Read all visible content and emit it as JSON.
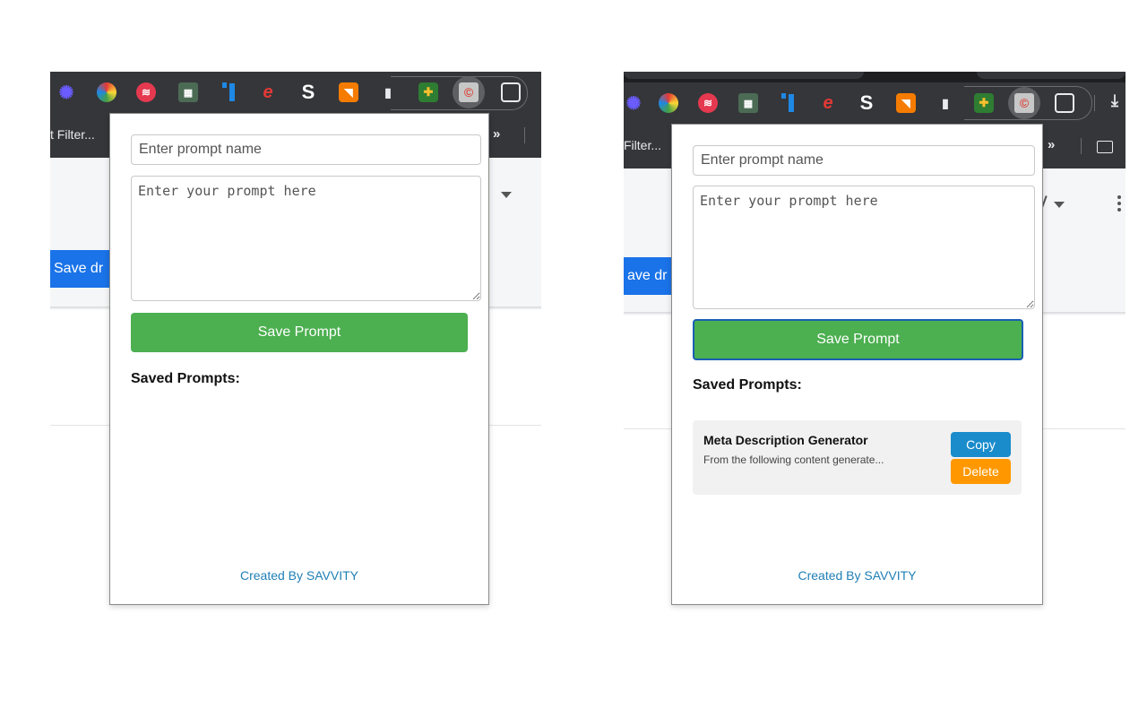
{
  "colors": {
    "chrome_dark": "#35363a",
    "save_button": "#4caf50",
    "copy_button": "#1a8ccc",
    "delete_button": "#ff9800",
    "link": "#1f7fb5",
    "page_button": "#1a73e8"
  },
  "left": {
    "bookmark_label": "t Filter...",
    "bookmark_more": "»",
    "page_button_label": "Save dr",
    "popup": {
      "name_placeholder": "Enter prompt name",
      "prompt_placeholder": "Enter your prompt here",
      "save_label": "Save Prompt",
      "saved_heading": "Saved Prompts:",
      "footer": "Created By SAVVITY"
    }
  },
  "right": {
    "bookmark_label": "Filter...",
    "bookmark_more": "»",
    "page_button_label": "ave dr",
    "popup": {
      "name_placeholder": "Enter prompt name",
      "prompt_placeholder": "Enter your prompt here",
      "save_label": "Save Prompt",
      "saved_heading": "Saved Prompts:",
      "prompts": [
        {
          "title": "Meta Description Generator",
          "preview": "From the following content generate...",
          "copy_label": "Copy",
          "delete_label": "Delete"
        }
      ],
      "footer": "Created By SAVVITY"
    }
  }
}
